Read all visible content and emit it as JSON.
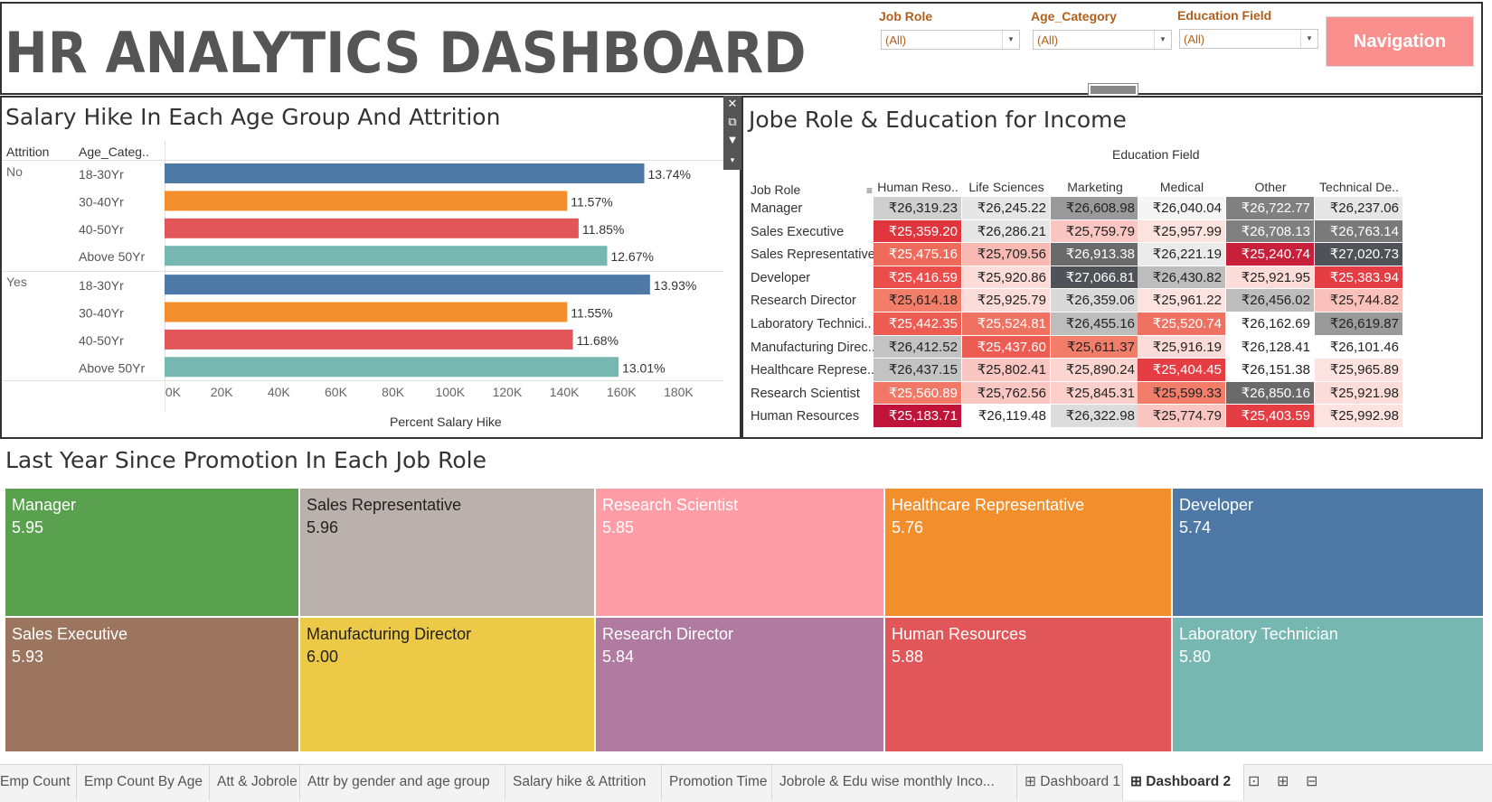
{
  "header": {
    "title": "HR ANALYTICS DASHBOARD",
    "filters": [
      {
        "label": "Job Role",
        "value": "(All)"
      },
      {
        "label": "Age_Category",
        "value": "(All)"
      },
      {
        "label": "Education Field",
        "value": "(All)"
      }
    ],
    "nav_label": "Navigation"
  },
  "salary_chart": {
    "title": "Salary Hike In Each Age Group And Attrition",
    "col_header_attrition": "Attrition",
    "col_header_age": "Age_Categ..",
    "xlabel": "Percent Salary Hike",
    "ticks": [
      "0K",
      "20K",
      "40K",
      "60K",
      "80K",
      "100K",
      "120K",
      "140K",
      "160K",
      "180K"
    ]
  },
  "chart_data": {
    "type": "bar",
    "orientation": "horizontal",
    "title": "Salary Hike In Each Age Group And Attrition",
    "xlabel": "Percent Salary Hike",
    "xlim": [
      0,
      190000
    ],
    "groups": [
      {
        "attrition": "No",
        "rows": [
          {
            "category": "18-30Yr",
            "value": 168000,
            "label": "13.74%",
            "color": "#4e79a7"
          },
          {
            "category": "30-40Yr",
            "value": 141000,
            "label": "11.57%",
            "color": "#f28e2b"
          },
          {
            "category": "40-50Yr",
            "value": 145000,
            "label": "11.85%",
            "color": "#e15759"
          },
          {
            "category": "Above 50Yr",
            "value": 155000,
            "label": "12.67%",
            "color": "#76b7b2"
          }
        ]
      },
      {
        "attrition": "Yes",
        "rows": [
          {
            "category": "18-30Yr",
            "value": 170000,
            "label": "13.93%",
            "color": "#4e79a7"
          },
          {
            "category": "30-40Yr",
            "value": 141000,
            "label": "11.55%",
            "color": "#f28e2b"
          },
          {
            "category": "40-50Yr",
            "value": 143000,
            "label": "11.68%",
            "color": "#e15759"
          },
          {
            "category": "Above 50Yr",
            "value": 159000,
            "label": "13.01%",
            "color": "#76b7b2"
          }
        ]
      }
    ]
  },
  "income_table": {
    "title": "Jobe Role & Education for Income",
    "column_group": "Education Field",
    "row_header": "Job Role",
    "columns": [
      "Human Reso..",
      "Life Sciences",
      "Marketing",
      "Medical",
      "Other",
      "Technical De.."
    ],
    "rows": [
      {
        "role": "Manager",
        "values": [
          "₹26,319.23",
          "₹26,245.22",
          "₹26,608.98",
          "₹26,040.04",
          "₹26,722.77",
          "₹26,237.06"
        ],
        "bg": [
          "#cfcfcf",
          "#e6e6e6",
          "#9a9a9a",
          "#f5f5f5",
          "#808080",
          "#e6e6e6"
        ],
        "fg": [
          "#222",
          "#222",
          "#222",
          "#222",
          "#fff",
          "#222"
        ]
      },
      {
        "role": "Sales Executive",
        "values": [
          "₹25,359.20",
          "₹26,286.21",
          "₹25,759.79",
          "₹25,957.99",
          "₹26,708.13",
          "₹26,763.14"
        ],
        "bg": [
          "#e0353d",
          "#e6e6e6",
          "#f9c6c2",
          "#fde3e0",
          "#808080",
          "#7a7a7a"
        ],
        "fg": [
          "#fff",
          "#222",
          "#222",
          "#222",
          "#fff",
          "#fff"
        ]
      },
      {
        "role": "Sales Representative",
        "values": [
          "₹25,475.16",
          "₹25,709.56",
          "₹26,913.38",
          "₹26,221.19",
          "₹25,240.74",
          "₹27,020.73"
        ],
        "bg": [
          "#ee6a5b",
          "#f8b9b2",
          "#6a6a6a",
          "#ebebeb",
          "#c8203a",
          "#4f5357"
        ],
        "fg": [
          "#fff",
          "#222",
          "#fff",
          "#222",
          "#fff",
          "#fff"
        ]
      },
      {
        "role": "Developer",
        "values": [
          "₹25,416.59",
          "₹25,920.86",
          "₹27,066.81",
          "₹26,430.82",
          "₹25,921.95",
          "₹25,383.94"
        ],
        "bg": [
          "#ea4d4a",
          "#fcdcd8",
          "#4f5357",
          "#bdbdbd",
          "#fcdcd8",
          "#e43e44"
        ],
        "fg": [
          "#fff",
          "#222",
          "#fff",
          "#222",
          "#222",
          "#fff"
        ]
      },
      {
        "role": "Research Director",
        "values": [
          "₹25,614.18",
          "₹25,925.79",
          "₹26,359.06",
          "₹25,961.22",
          "₹26,456.02",
          "₹25,744.82"
        ],
        "bg": [
          "#f27e69",
          "#fcdcd8",
          "#d9d9d9",
          "#fde3e0",
          "#bdbdbd",
          "#f9c1ba"
        ],
        "fg": [
          "#222",
          "#222",
          "#222",
          "#222",
          "#222",
          "#222"
        ]
      },
      {
        "role": "Laboratory Technici..",
        "values": [
          "₹25,442.35",
          "₹25,524.81",
          "₹26,455.16",
          "₹25,520.74",
          "₹26,162.69",
          "₹26,619.87"
        ],
        "bg": [
          "#ec5c52",
          "#ef7162",
          "#bdbdbd",
          "#ef7162",
          "#ffffff",
          "#9a9a9a"
        ],
        "fg": [
          "#fff",
          "#fff",
          "#222",
          "#fff",
          "#222",
          "#222"
        ]
      },
      {
        "role": "Manufacturing Direc..",
        "values": [
          "₹26,412.52",
          "₹25,437.60",
          "₹25,611.37",
          "₹25,916.19",
          "₹26,128.41",
          "₹26,101.46"
        ],
        "bg": [
          "#c3c3c3",
          "#ec5c52",
          "#f27e69",
          "#fcdcd8",
          "#ffffff",
          "#ffffff"
        ],
        "fg": [
          "#222",
          "#fff",
          "#222",
          "#222",
          "#222",
          "#222"
        ]
      },
      {
        "role": "Healthcare Represe..",
        "values": [
          "₹26,437.15",
          "₹25,802.41",
          "₹25,890.24",
          "₹25,404.45",
          "₹26,151.38",
          "₹25,965.89"
        ],
        "bg": [
          "#c3c3c3",
          "#f9c6c2",
          "#fcd5d0",
          "#e43e44",
          "#ffffff",
          "#fde3e0"
        ],
        "fg": [
          "#222",
          "#222",
          "#222",
          "#fff",
          "#222",
          "#222"
        ]
      },
      {
        "role": "Research Scientist",
        "values": [
          "₹25,560.89",
          "₹25,762.56",
          "₹25,845.31",
          "₹25,599.33",
          "₹26,850.16",
          "₹25,921.98"
        ],
        "bg": [
          "#f17866",
          "#f9c6c2",
          "#fbd0cb",
          "#f27e69",
          "#6a6a6a",
          "#fcdcd8"
        ],
        "fg": [
          "#fff",
          "#222",
          "#222",
          "#222",
          "#fff",
          "#222"
        ]
      },
      {
        "role": "Human Resources",
        "values": [
          "₹25,183.71",
          "₹26,119.48",
          "₹26,322.98",
          "₹25,774.79",
          "₹25,403.59",
          "₹25,992.98"
        ],
        "bg": [
          "#c0133a",
          "#ffffff",
          "#dcdcdc",
          "#f9c6c2",
          "#e43e44",
          "#fde3e0"
        ],
        "fg": [
          "#fff",
          "#222",
          "#222",
          "#222",
          "#fff",
          "#222"
        ]
      }
    ]
  },
  "promotion": {
    "title": "Last Year Since Promotion In Each Job Role",
    "tiles": [
      {
        "role": "Manager",
        "value": "5.95",
        "color": "#59a14f"
      },
      {
        "role": "Sales Representative",
        "value": "5.96",
        "color": "#bab0ac"
      },
      {
        "role": "Research Scientist",
        "value": "5.85",
        "color": "#ff9da7"
      },
      {
        "role": "Healthcare Representative",
        "value": "5.76",
        "color": "#f28e2b"
      },
      {
        "role": "Developer",
        "value": "5.74",
        "color": "#4e79a7"
      },
      {
        "role": "Sales Executive",
        "value": "5.93",
        "color": "#9c755f"
      },
      {
        "role": "Manufacturing Director",
        "value": "6.00",
        "color": "#edc948"
      },
      {
        "role": "Research Director",
        "value": "5.84",
        "color": "#b07aa1"
      },
      {
        "role": "Human Resources",
        "value": "5.88",
        "color": "#e15759"
      },
      {
        "role": "Laboratory Technician",
        "value": "5.80",
        "color": "#76b7b2"
      }
    ]
  },
  "tabs": [
    "Emp Count",
    "Emp Count By Age",
    "Att & Jobrole",
    "Attr by gender and age group",
    "Salary hike & Attrition",
    "Promotion Time",
    "Jobrole & Edu wise monthly Inco...",
    "Dashboard 1",
    "Dashboard 2"
  ],
  "tab_icons": [
    "dashboard-icon",
    "dashboard-icon"
  ]
}
